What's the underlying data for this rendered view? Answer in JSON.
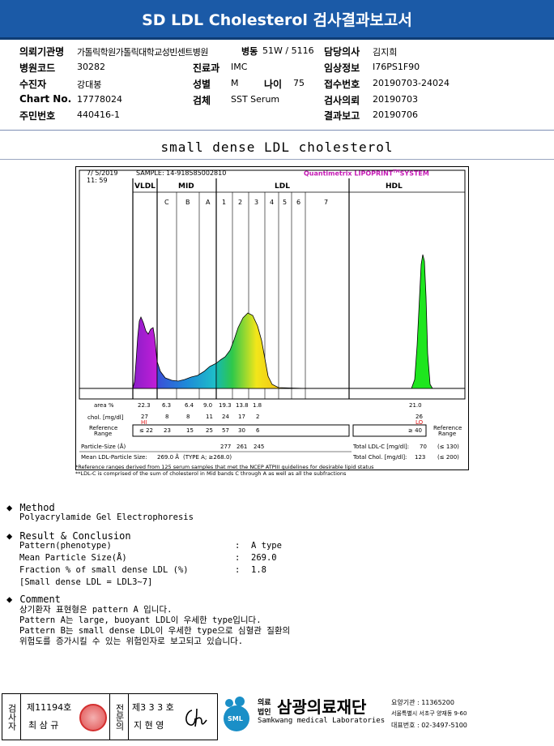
{
  "title": "SD LDL Cholesterol 검사결과보고서",
  "info": {
    "inst_label": "의뢰기관명",
    "inst_value": "가톨릭학원가톨릭대학교성빈센트병원",
    "ward_label": "병동",
    "ward_value": "51W / 5116",
    "doctor_label": "담당의사",
    "doctor_value": "김지희",
    "hosp_code_label": "병원코드",
    "hosp_code_value": "30282",
    "dept_label": "진료과",
    "dept_value": "IMC",
    "clinical_label": "임상정보",
    "clinical_value": "I76PS1F90",
    "patient_label": "수진자",
    "patient_value": "강대봉",
    "sex_label": "성별",
    "sex_value": "M",
    "age_label": "나이",
    "age_value": "75",
    "receipt_label": "접수번호",
    "receipt_value": "20190703-24024",
    "chart_label": "Chart No.",
    "chart_value": "17778024",
    "specimen_label": "검체",
    "specimen_value": "SST Serum",
    "request_label": "검사의뢰",
    "request_value": "20190703",
    "rrn_label": "주민번호",
    "rrn_value": "440416-1",
    "report_label": "결과보고",
    "report_value": "20190706"
  },
  "chart_heading": "small dense LDL cholesterol",
  "report": {
    "date": "7/ 5/2019",
    "time": "11: 59",
    "sample": "SAMPLE:   14-918585002810",
    "brand": "Quantimetrix LIPOPRINT",
    "brand_tm": "TM",
    "brand_suffix": "SYSTEM",
    "groups": [
      "VLDL",
      "MID",
      "LDL",
      "HDL"
    ],
    "bands": [
      "C",
      "B",
      "A",
      "1",
      "2",
      "3",
      "4",
      "5",
      "6",
      "7"
    ],
    "area_label": "area %",
    "area_values": [
      "22.3",
      "6.3",
      "6.4",
      "9.0",
      "19.3",
      "13.8",
      "1.8",
      "21.0"
    ],
    "chol_label": "chol. [mg/dl]",
    "chol_values": [
      "27",
      "8",
      "8",
      "11",
      "24",
      "17",
      "2",
      "26"
    ],
    "hi_flag": "HI",
    "lo_flag": "LO",
    "ref_label_1": "Reference",
    "ref_label_2": "Range",
    "ref_values": [
      "≤ 22",
      "23",
      "15",
      "25",
      "57",
      "30",
      "6",
      "≥ 40"
    ],
    "particle_size_label": "Particle-Size (Å)",
    "particle_sizes": [
      "277",
      "261",
      "245"
    ],
    "mean_size_label": "Mean LDL-Particle Size:",
    "mean_size_value": "269.0 Å",
    "mean_size_type": "(TYPE A; ≥268.0)",
    "total_ldl_label": "Total LDL-C [mg/dl]:",
    "total_ldl_value": "70",
    "total_ldl_ref": "(≤ 130)",
    "total_chol_label": "Total Chol. [mg/dl]:",
    "total_chol_value": "123",
    "total_chol_ref": "(≤ 200)",
    "note1": "*Reference ranges derived from 125 serum samples that met the NCEP ATPIII guidelines for desirable lipid status",
    "note2": "**LDL-C is comprised of the sum of cholesterol in Mid bands C through A as well as all the subfractions"
  },
  "method": {
    "heading": "Method",
    "text": "Polyacrylamide Gel Electrophoresis"
  },
  "result": {
    "heading": "Result & Conclusion",
    "rows": [
      {
        "label": "Pattern(phenotype)",
        "colon": ":",
        "value": "A type"
      },
      {
        "label": "Mean Particle Size(Å)",
        "colon": ":",
        "value": "269.0"
      },
      {
        "label": "Fraction % of small dense LDL (%)",
        "colon": ":",
        "value": "1.8"
      }
    ],
    "note": "[Small dense LDL = LDL3~7]"
  },
  "comment": {
    "heading": "Comment",
    "lines": [
      "상기환자 표현형은 pattern A 입니다.",
      "Pattern A는 large, buoyant LDL이 우세한 type입니다.",
      "Pattern B는 small dense LDL이 우세한 type으로 심혈관 질환의",
      "위험도를 증가시킬 수 있는 위험인자로 보고되고 있습니다."
    ]
  },
  "footer": {
    "examiner_label": "검사자",
    "examiner_license": "제11194호",
    "examiner_name": "최 삼 규",
    "specialist_label": "전문의",
    "specialist_license": "제3 3 3 호",
    "specialist_name": "지 현 영",
    "corp_label_1": "의료",
    "corp_label_2": "법인",
    "company_name": "삼광의료재단",
    "company_en": "Samkwang medical Laboratories",
    "logo_text": "SML",
    "care_code": "요양기관 : 11365200",
    "address": "서울특별시 서초구 양재동 9-60",
    "phone": "대표번호 : 02-3497-5100",
    "colors": {
      "title_bar": "#1b5aa7",
      "logo": "#1a8fc7"
    }
  }
}
